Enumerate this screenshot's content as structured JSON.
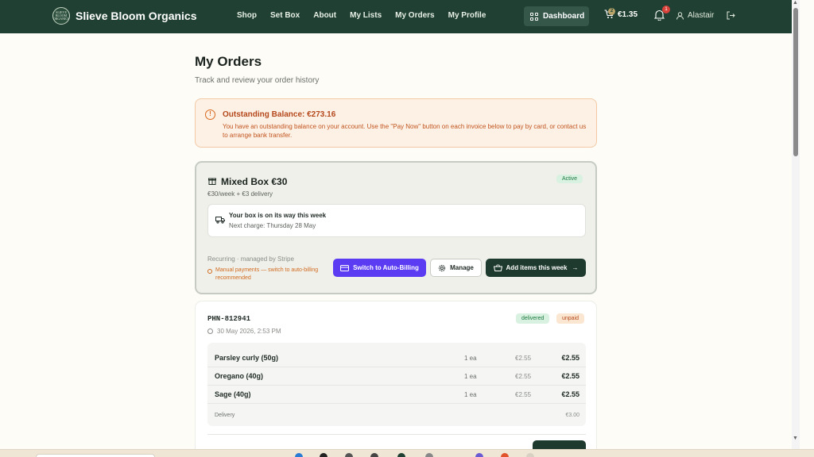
{
  "header": {
    "brand": "Slieve Bloom Organics",
    "logo_text": "SLIEVE BLOOM ORGANICS",
    "nav": [
      "Shop",
      "Set Box",
      "About",
      "My Lists",
      "My Orders",
      "My Profile"
    ],
    "dashboard_label": "Dashboard",
    "cart_count": "2",
    "cart_total": "€1.35",
    "notification_count": "1",
    "user_name": "Alastair"
  },
  "page": {
    "title": "My Orders",
    "subtitle": "Track and review your order history"
  },
  "alert": {
    "title": "Outstanding Balance: €273.16",
    "text": "You have an outstanding balance on your account. Use the \"Pay Now\" button on each invoice below to pay by card, or contact us to arrange bank transfer."
  },
  "subscription": {
    "name": "Mixed Box €30",
    "price": "€30/week + €3 delivery",
    "status": "Active",
    "delivery_title": "Your box is on its way this week",
    "next_charge": "Next charge: Thursday 28 May",
    "recurring": "Recurring · managed by Stripe",
    "warning": "Manual payments — switch to auto-billing recommended",
    "btn_auto": "Switch to Auto-Billing",
    "btn_manage": "Manage",
    "btn_add": "Add items this week"
  },
  "order": {
    "id": "PHN-812941",
    "date": "30 May 2026, 2:53 PM",
    "status_delivery": "delivered",
    "status_payment": "unpaid",
    "items": [
      {
        "name": "Parsley curly (50g)",
        "qty": "1 ea",
        "unit": "€2.55",
        "total": "€2.55"
      },
      {
        "name": "Oregano (40g)",
        "qty": "1 ea",
        "unit": "€2.55",
        "total": "€2.55"
      },
      {
        "name": "Sage (40g)",
        "qty": "1 ea",
        "unit": "€2.55",
        "total": "€2.55"
      }
    ],
    "delivery_label": "Delivery",
    "delivery_value": "€3.00"
  },
  "colors": {
    "header_bg": "#1f4032",
    "accent_purple": "#5b3cf2",
    "accent_green": "#1e3a2e",
    "warning_orange": "#d9691e"
  }
}
